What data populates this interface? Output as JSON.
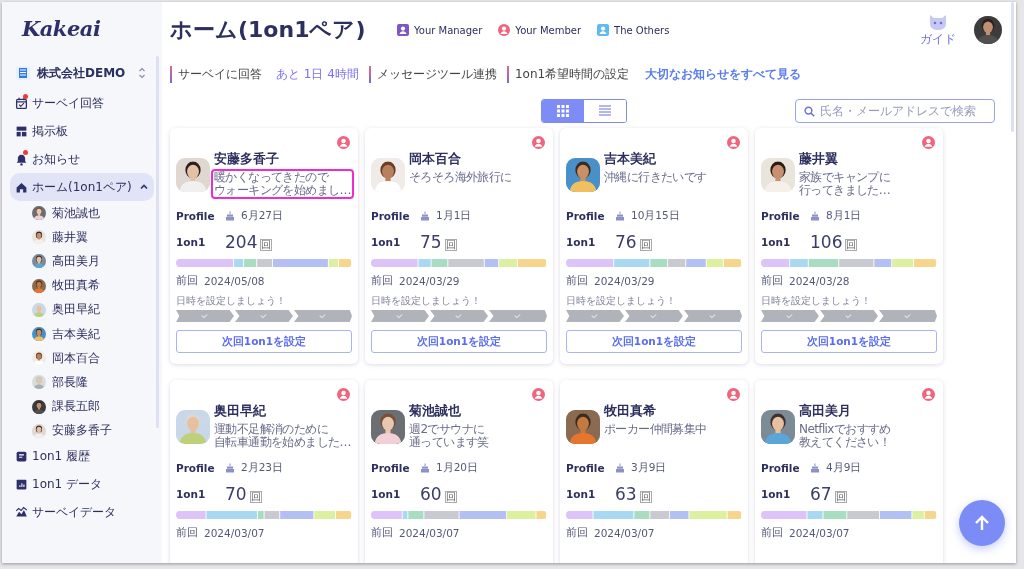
{
  "sidebar": {
    "logo": "Kakeai",
    "org": "株式会社DEMO",
    "items": [
      {
        "label": "サーベイ回答",
        "selected": false,
        "dot": true
      },
      {
        "label": "掲示板",
        "selected": false,
        "dot": false
      },
      {
        "label": "お知らせ",
        "selected": false,
        "dot": true
      },
      {
        "label": "ホーム(1on1ペア)",
        "selected": true,
        "dot": false,
        "expanded": true,
        "children": [
          {
            "label": "菊池誠也",
            "selected": false
          },
          {
            "label": "藤井翼",
            "selected": false
          },
          {
            "label": "高田美月",
            "selected": false
          },
          {
            "label": "牧田真希",
            "selected": false
          },
          {
            "label": "奥田早紀",
            "selected": false
          },
          {
            "label": "吉本美紀",
            "selected": false
          },
          {
            "label": "岡本百合",
            "selected": false
          },
          {
            "label": "部長隆",
            "selected": false
          },
          {
            "label": "課長五郎",
            "selected": false
          },
          {
            "label": "安藤多香子",
            "selected": false
          }
        ]
      },
      {
        "label": "1on1 履歴",
        "selected": false,
        "dot": false
      },
      {
        "label": "1on1 データ",
        "selected": false,
        "dot": false
      },
      {
        "label": "サーベイデータ",
        "selected": false,
        "dot": false
      }
    ]
  },
  "header": {
    "title": "ホーム(1on1ペア)",
    "legend": [
      {
        "label": "Your Manager",
        "color": "#7e57c2"
      },
      {
        "label": "Your Member",
        "color": "#f0647c"
      },
      {
        "label": "The Others",
        "color": "#5cbcf2"
      }
    ],
    "guide": "ガイド"
  },
  "notices": {
    "items": [
      {
        "label": "サーベイに回答",
        "note": "あと 1日 4時間"
      },
      {
        "label": "メッセージツール連携"
      },
      {
        "label": "1on1希望時間の設定"
      }
    ],
    "link": "大切なお知らせをすべて見る"
  },
  "view_toggle": [
    {
      "kind": "grid",
      "selected": true
    },
    {
      "kind": "list",
      "selected": false
    }
  ],
  "search": {
    "placeholder": "氏名・メールアドレスで検索"
  },
  "cards": [
    {
      "name": "安藤多香子",
      "message": [
        "暖かくなってきたので",
        "ウォーキングを始めまし…"
      ],
      "highlighted": true,
      "profile_label": "Profile",
      "birthday": "6月27日",
      "count_label": "1on1",
      "count": "204",
      "unit": "回",
      "last_label": "前回",
      "last": "2024/05/08",
      "prompt": "日時を設定しましょう！",
      "steps": [
        {
          "checked": true
        },
        {
          "checked": true
        },
        {
          "checked": true
        }
      ],
      "button": "次回1on1を設定"
    },
    {
      "name": "岡本百合",
      "message": [
        "そろそろ海外旅行に"
      ],
      "highlighted": false,
      "profile_label": "Profile",
      "birthday": "1月1日",
      "count_label": "1on1",
      "count": "75",
      "unit": "回",
      "last_label": "前回",
      "last": "2024/03/29",
      "prompt": "日時を設定しましょう！",
      "steps": [
        {
          "checked": true
        },
        {
          "checked": true
        },
        {
          "checked": true
        }
      ],
      "button": "次回1on1を設定"
    },
    {
      "name": "吉本美紀",
      "message": [
        "沖縄に行きたいです"
      ],
      "highlighted": false,
      "profile_label": "Profile",
      "birthday": "10月15日",
      "count_label": "1on1",
      "count": "76",
      "unit": "回",
      "last_label": "前回",
      "last": "2024/03/29",
      "prompt": "日時を設定しましょう！",
      "steps": [
        {
          "checked": true
        },
        {
          "checked": true
        },
        {
          "checked": true
        }
      ],
      "button": "次回1on1を設定"
    },
    {
      "name": "藤井翼",
      "message": [
        "家族でキャンプに",
        "行ってきました…"
      ],
      "highlighted": false,
      "profile_label": "Profile",
      "birthday": "8月1日",
      "count_label": "1on1",
      "count": "106",
      "unit": "回",
      "last_label": "前回",
      "last": "2024/03/28",
      "prompt": "日時を設定しましょう！",
      "steps": [
        {
          "checked": true
        },
        {
          "checked": true
        },
        {
          "checked": true
        }
      ],
      "button": "次回1on1を設定"
    },
    {
      "name": "奥田早紀",
      "message": [
        "運動不足解消のために",
        "自転車通勤を始めました…"
      ],
      "highlighted": false,
      "profile_label": "Profile",
      "birthday": "2月23日",
      "count_label": "1on1",
      "count": "70",
      "unit": "回",
      "last_label": "前回",
      "last": "2024/03/07"
    },
    {
      "name": "菊池誠也",
      "message": [
        "週2でサウナに",
        "通っています笑"
      ],
      "highlighted": false,
      "profile_label": "Profile",
      "birthday": "1月20日",
      "count_label": "1on1",
      "count": "60",
      "unit": "回",
      "last_label": "前回",
      "last": "2024/03/07"
    },
    {
      "name": "牧田真希",
      "message": [
        "ポーカー仲間募集中"
      ],
      "highlighted": false,
      "profile_label": "Profile",
      "birthday": "3月9日",
      "count_label": "1on1",
      "count": "63",
      "unit": "回",
      "last_label": "前回",
      "last": "2024/03/07"
    },
    {
      "name": "高田美月",
      "message": [
        "Netflixでおすすめ",
        "教えてください！"
      ],
      "highlighted": false,
      "profile_label": "Profile",
      "birthday": "4月9日",
      "count_label": "1on1",
      "count": "67",
      "unit": "回",
      "last_label": "前回",
      "last": "2024/03/07"
    }
  ]
}
